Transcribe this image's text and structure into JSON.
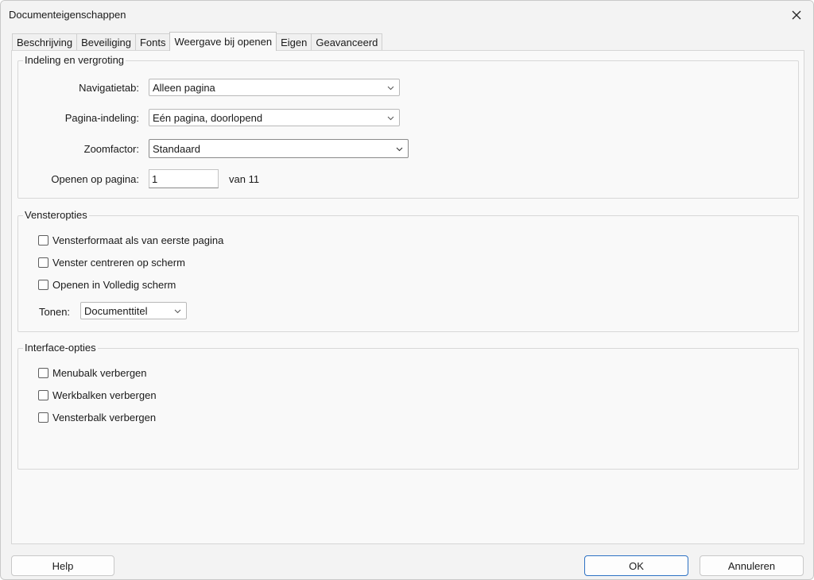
{
  "window": {
    "title": "Documenteigenschappen",
    "close_icon": "close-icon"
  },
  "tabs": [
    {
      "label": "Beschrijving"
    },
    {
      "label": "Beveiliging"
    },
    {
      "label": "Fonts"
    },
    {
      "label": "Weergave bij openen",
      "active": true
    },
    {
      "label": "Eigen"
    },
    {
      "label": "Geavanceerd"
    }
  ],
  "layout_group": {
    "legend": "Indeling en vergroting",
    "nav_tab": {
      "label": "Navigatietab:",
      "value": "Alleen pagina"
    },
    "page_layout": {
      "label": "Pagina-indeling:",
      "value": "Eén pagina, doorlopend"
    },
    "zoom": {
      "label": "Zoomfactor:",
      "value": "Standaard"
    },
    "open_page": {
      "label": "Openen op pagina:",
      "value": "1",
      "suffix": "van 11"
    }
  },
  "window_group": {
    "legend": "Vensteropties",
    "checkboxes": [
      {
        "label": "Vensterformaat als van eerste pagina",
        "checked": false
      },
      {
        "label": "Venster centreren op scherm",
        "checked": false
      },
      {
        "label": "Openen in Volledig scherm",
        "checked": false
      }
    ],
    "show": {
      "label": "Tonen:",
      "value": "Documenttitel"
    }
  },
  "interface_group": {
    "legend": "Interface-opties",
    "checkboxes": [
      {
        "label": "Menubalk verbergen",
        "checked": false
      },
      {
        "label": "Werkbalken verbergen",
        "checked": false
      },
      {
        "label": "Vensterbalk verbergen",
        "checked": false
      }
    ]
  },
  "footer": {
    "help": "Help",
    "ok": "OK",
    "cancel": "Annuleren"
  },
  "colors": {
    "dialog_bg": "#f3f3f3",
    "panel_bg": "#f9f9f9",
    "primary_border": "#2d72c4"
  }
}
